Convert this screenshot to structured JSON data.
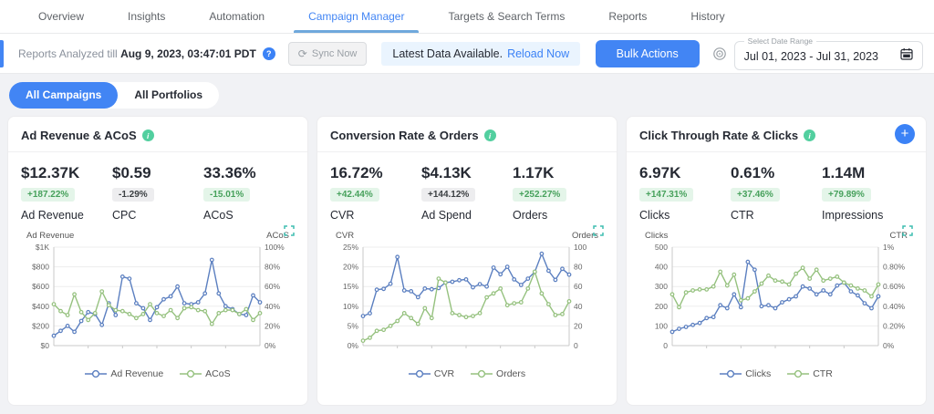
{
  "nav": {
    "tabs": [
      {
        "label": "Overview"
      },
      {
        "label": "Insights"
      },
      {
        "label": "Automation"
      },
      {
        "label": "Campaign Manager"
      },
      {
        "label": "Targets & Search Terms"
      },
      {
        "label": "Reports"
      },
      {
        "label": "History"
      }
    ]
  },
  "toolbar": {
    "reports_prefix": "Reports Analyzed till ",
    "reports_date": "Aug 9, 2023, 03:47:01 PDT",
    "question_glyph": "?",
    "sync_glyph": "⟳",
    "sync_label": "Sync Now",
    "latest_data_text": "Latest Data Available.",
    "reload_label": "Reload Now",
    "bulk_actions_label": "Bulk Actions",
    "date_range_label": "Select Date Range",
    "date_range_value": "Jul 01, 2023 - Jul 31, 2023"
  },
  "filters": {
    "all_campaigns": "All Campaigns",
    "all_portfolios": "All Portfolios"
  },
  "colors": {
    "accent_blue": "#4285f4",
    "link_blue": "#3b82f6",
    "line_blue": "#5b7fc0",
    "line_green": "#95c17e",
    "badge_green_bg": "#e4f5e9",
    "badge_green_text": "#47a15c",
    "info_icon_green": "#52cf9f",
    "expand_icon_teal": "#3fbdb0"
  },
  "cards": [
    {
      "title": "Ad Revenue & ACoS",
      "info_glyph": "i",
      "kpis": [
        {
          "value": "$12.37K",
          "badge": "+187.22%",
          "variant": "green",
          "label": "Ad Revenue"
        },
        {
          "value": "$0.59",
          "badge": "-1.29%",
          "variant": "grey",
          "label": "CPC"
        },
        {
          "value": "33.36%",
          "badge": "-15.01%",
          "variant": "green",
          "label": "ACoS"
        }
      ]
    },
    {
      "title": "Conversion Rate & Orders",
      "info_glyph": "i",
      "kpis": [
        {
          "value": "16.72%",
          "badge": "+42.44%",
          "variant": "green",
          "label": "CVR"
        },
        {
          "value": "$4.13K",
          "badge": "+144.12%",
          "variant": "grey",
          "label": "Ad Spend"
        },
        {
          "value": "1.17K",
          "badge": "+252.27%",
          "variant": "green",
          "label": "Orders"
        }
      ]
    },
    {
      "title": "Click Through Rate & Clicks",
      "info_glyph": "i",
      "plus_glyph": "+",
      "kpis": [
        {
          "value": "6.97K",
          "badge": "+147.31%",
          "variant": "green",
          "label": "Clicks"
        },
        {
          "value": "0.61%",
          "badge": "+37.46%",
          "variant": "green",
          "label": "CTR"
        },
        {
          "value": "1.14M",
          "badge": "+79.89%",
          "variant": "green",
          "label": "Impressions"
        }
      ]
    }
  ],
  "chart_data": [
    {
      "type": "line",
      "left_axis": {
        "label": "Ad Revenue",
        "ticks": [
          "$1K",
          "$800",
          "$600",
          "$400",
          "$200",
          "$0"
        ],
        "min": 0,
        "max": 1000
      },
      "right_axis": {
        "label": "ACoS",
        "ticks": [
          "100%",
          "80%",
          "60%",
          "40%",
          "20%",
          "0%"
        ],
        "min": 0,
        "max": 100
      },
      "series": [
        {
          "name": "Ad Revenue",
          "axis": "left",
          "color": "#5b7fc0",
          "values": [
            100,
            150,
            200,
            140,
            250,
            340,
            320,
            210,
            430,
            310,
            700,
            680,
            430,
            380,
            260,
            390,
            470,
            500,
            600,
            430,
            420,
            440,
            530,
            870,
            530,
            400,
            370,
            320,
            310,
            510,
            440
          ]
        },
        {
          "name": "ACoS",
          "axis": "right",
          "color": "#95c17e",
          "values": [
            42,
            35,
            31,
            52,
            34,
            26,
            33,
            55,
            41,
            36,
            35,
            32,
            28,
            32,
            42,
            33,
            30,
            36,
            28,
            38,
            39,
            36,
            35,
            22,
            33,
            36,
            36,
            32,
            37,
            26,
            33
          ]
        }
      ]
    },
    {
      "type": "line",
      "left_axis": {
        "label": "CVR",
        "ticks": [
          "25%",
          "20%",
          "15%",
          "10%",
          "5%",
          "0%"
        ],
        "min": 0,
        "max": 25
      },
      "right_axis": {
        "label": "Orders",
        "ticks": [
          "100",
          "80",
          "60",
          "40",
          "20",
          "0"
        ],
        "min": 0,
        "max": 100
      },
      "series": [
        {
          "name": "CVR",
          "axis": "left",
          "color": "#5b7fc0",
          "values": [
            7.5,
            8.2,
            14.2,
            14.4,
            15.7,
            22.5,
            14,
            13.8,
            12.3,
            14.5,
            14.3,
            14.6,
            16,
            16.2,
            16.6,
            16.8,
            14.8,
            15.6,
            15,
            19.8,
            18.1,
            20,
            16.8,
            15.4,
            17,
            18.7,
            23.3,
            19,
            16.7,
            19.5,
            18
          ]
        },
        {
          "name": "Orders",
          "axis": "right",
          "color": "#95c17e",
          "values": [
            5,
            8,
            15,
            16,
            20,
            25,
            33,
            28,
            22,
            38,
            28,
            68,
            64,
            33,
            31,
            29,
            30,
            33,
            49,
            53,
            58,
            41,
            43,
            44,
            58,
            75,
            53,
            42,
            31,
            32,
            45
          ]
        }
      ]
    },
    {
      "type": "line",
      "left_axis": {
        "label": "Clicks",
        "ticks": [
          "500",
          "400",
          "300",
          "200",
          "100",
          "0"
        ],
        "min": 0,
        "max": 500
      },
      "right_axis": {
        "label": "CTR",
        "ticks": [
          "1%",
          "0.80%",
          "0.60%",
          "0.40%",
          "0.20%",
          "0%"
        ],
        "min": 0,
        "max": 1
      },
      "series": [
        {
          "name": "Clicks",
          "axis": "left",
          "color": "#5b7fc0",
          "values": [
            70,
            85,
            95,
            105,
            115,
            140,
            145,
            205,
            190,
            260,
            195,
            425,
            385,
            200,
            205,
            190,
            220,
            235,
            250,
            300,
            290,
            260,
            280,
            260,
            305,
            320,
            275,
            255,
            215,
            190,
            250
          ]
        },
        {
          "name": "CTR",
          "axis": "right",
          "color": "#95c17e",
          "values": [
            0.52,
            0.39,
            0.54,
            0.56,
            0.57,
            0.57,
            0.6,
            0.75,
            0.61,
            0.72,
            0.46,
            0.48,
            0.55,
            0.63,
            0.71,
            0.66,
            0.65,
            0.62,
            0.73,
            0.79,
            0.68,
            0.77,
            0.66,
            0.68,
            0.7,
            0.64,
            0.61,
            0.58,
            0.56,
            0.5,
            0.62
          ]
        }
      ]
    }
  ]
}
